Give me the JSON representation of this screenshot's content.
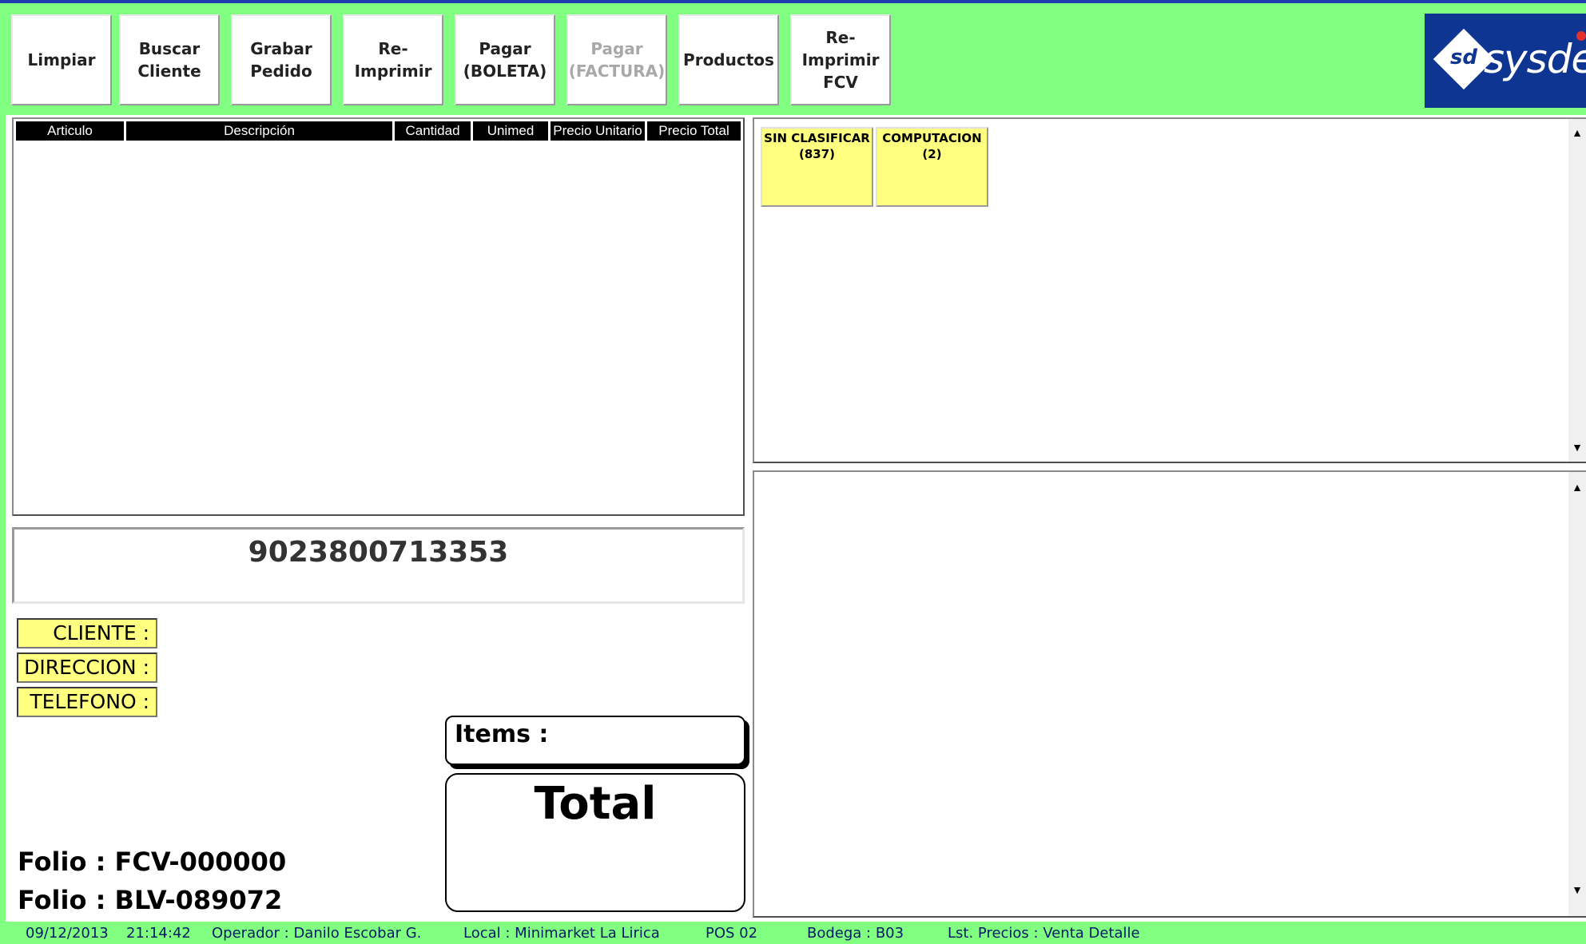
{
  "toolbar": {
    "buttons": [
      {
        "label": "Limpiar",
        "enabled": true
      },
      {
        "label": "Buscar\nCliente",
        "enabled": true
      },
      {
        "label": "Grabar\nPedido",
        "enabled": true
      },
      {
        "label": "Re-Imprimir",
        "enabled": true
      },
      {
        "label": "Pagar\n(BOLETA)",
        "enabled": true
      },
      {
        "label": "Pagar\n(FACTURA)",
        "enabled": false
      },
      {
        "label": "Productos",
        "enabled": true
      },
      {
        "label": "Re-Imprimir\nFCV",
        "enabled": true
      }
    ]
  },
  "logo": {
    "mark": "sd",
    "text": "sysdev"
  },
  "grid": {
    "columns": [
      "Articulo",
      "Descripción",
      "Cantidad",
      "Unimed",
      "Precio Unitario",
      "Precio Total"
    ],
    "rows": []
  },
  "barcode": {
    "value": "9023800713353"
  },
  "customer": {
    "cliente_label": "CLIENTE :",
    "direccion_label": "DIRECCION :",
    "telefono_label": "TELEFONO :"
  },
  "totals": {
    "items_label": "Items :",
    "total_label": "Total"
  },
  "folios": {
    "fcv": "Folio : FCV-000000",
    "blv": "Folio : BLV-089072"
  },
  "categories": [
    {
      "label": "SIN CLASIFICAR\n(837)"
    },
    {
      "label": "COMPUTACION\n(2)"
    }
  ],
  "statusbar": {
    "date": "09/12/2013",
    "time": "21:14:42",
    "operador": "Operador : Danilo Escobar G.",
    "local": "Local : Minimarket La Lirica",
    "pos": "POS 02",
    "bodega": "Bodega : B03",
    "lista": "Lst. Precios : Venta Detalle"
  },
  "colors": {
    "toolbar_bg": "#80ff80",
    "label_yellow": "#ffff80",
    "logo_blue": "#0e3591"
  },
  "icons": {
    "scroll_up": "scroll-up-arrow-icon",
    "scroll_down": "scroll-down-arrow-icon"
  }
}
